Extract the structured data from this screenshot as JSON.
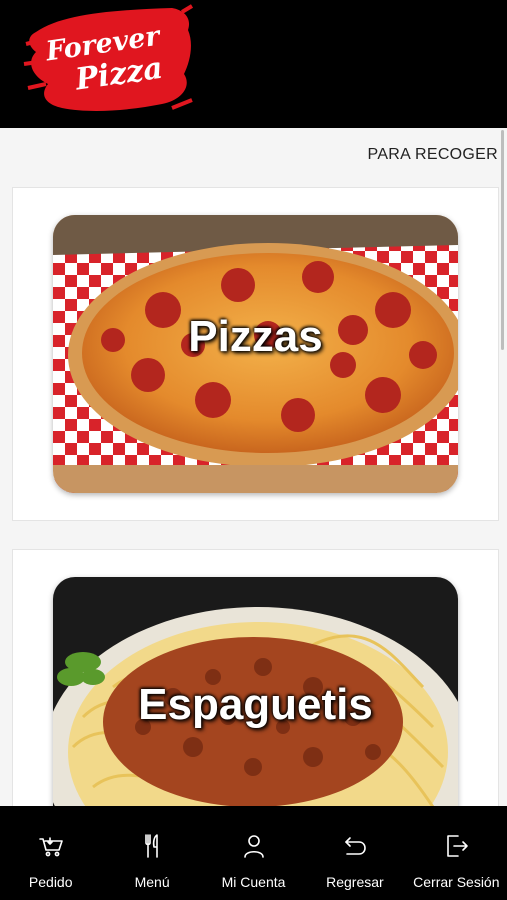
{
  "header": {
    "logo_line1": "Forever",
    "logo_line2": "Pizza",
    "logo_icon": "forever-pizza-logo"
  },
  "main": {
    "order_type": "PARA RECOGER",
    "categories": [
      {
        "label": "Pizzas",
        "image": "pepperoni-pizza-photo"
      },
      {
        "label": "Espaguetis",
        "image": "spaghetti-bolognese-photo"
      }
    ]
  },
  "bottom_nav": [
    {
      "label": "Pedido",
      "icon": "cart-icon"
    },
    {
      "label": "Menú",
      "icon": "fork-knife-icon"
    },
    {
      "label": "Mi Cuenta",
      "icon": "user-icon"
    },
    {
      "label": "Regresar",
      "icon": "back-arrow-icon"
    },
    {
      "label": "Cerrar Sesión",
      "icon": "logout-icon"
    }
  ],
  "colors": {
    "header_bg": "#000000",
    "logo_red": "#e0161f",
    "nav_bg": "#000000",
    "content_bg": "#f5f5f5"
  }
}
